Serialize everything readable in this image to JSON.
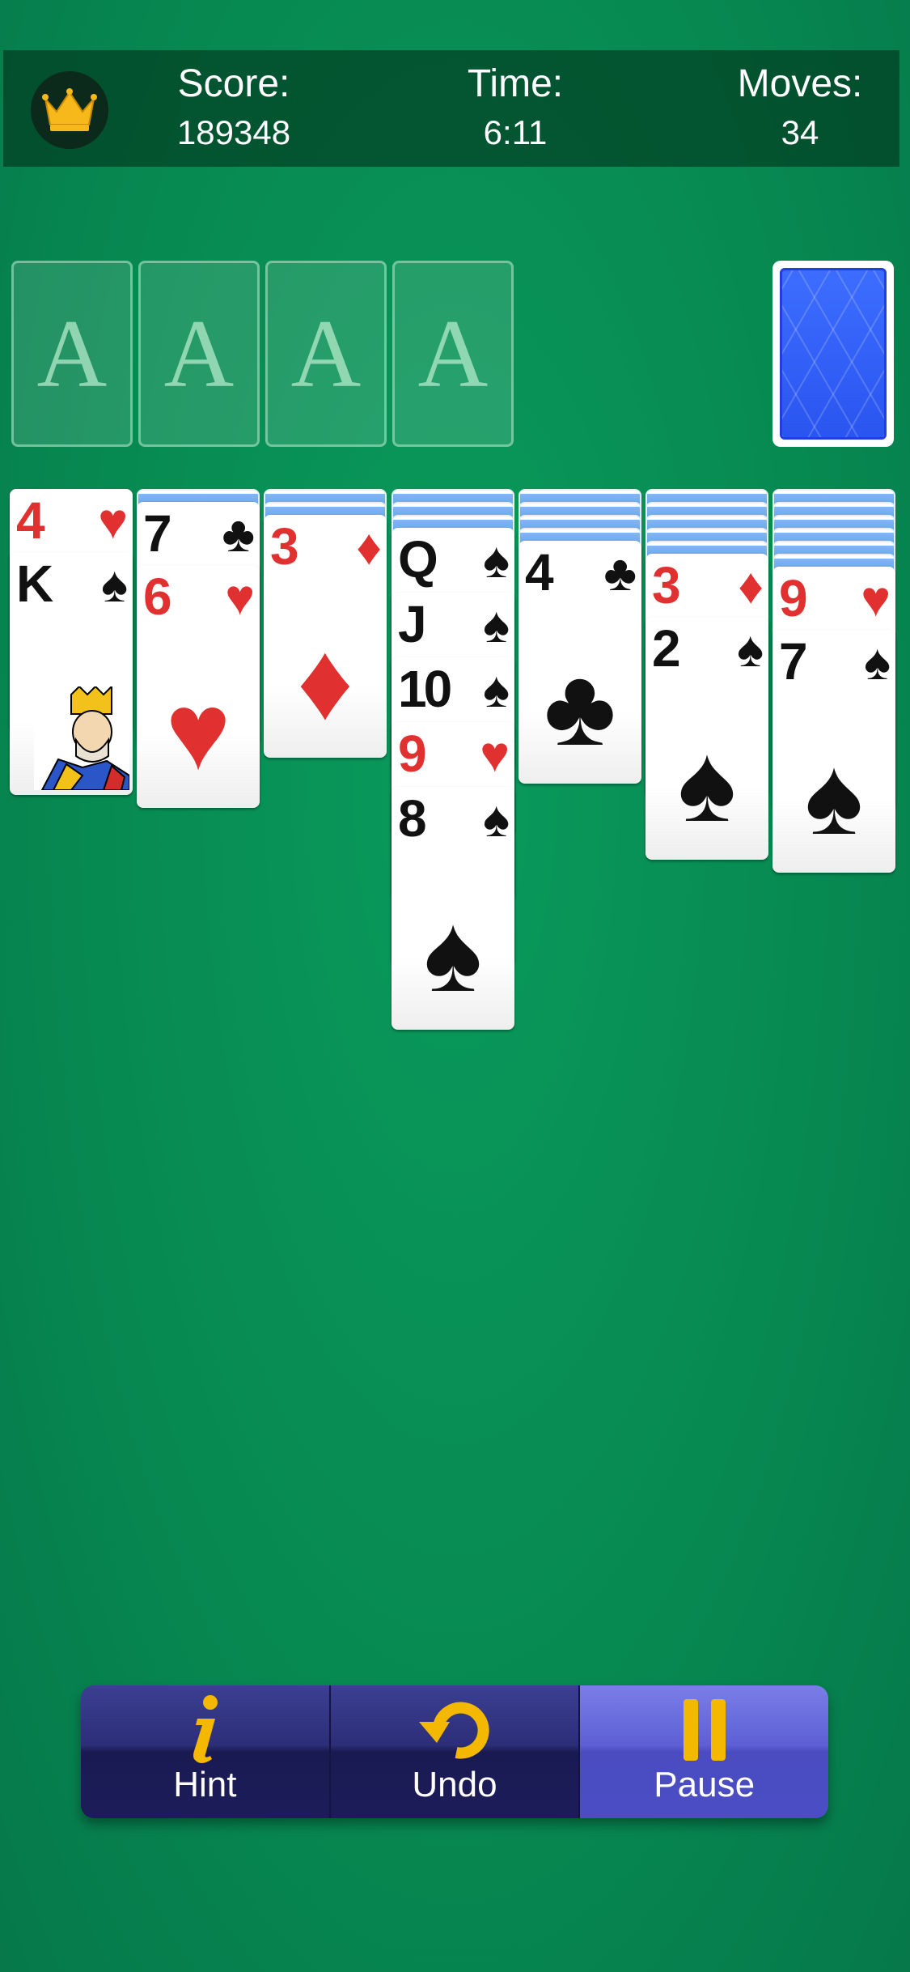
{
  "header": {
    "score_label": "Score:",
    "score_value": "189348",
    "time_label": "Time:",
    "time_value": "6:11",
    "moves_label": "Moves:",
    "moves_value": "34",
    "crown_icon": "crown-icon"
  },
  "foundations": [
    "A",
    "A",
    "A",
    "A"
  ],
  "stock": {
    "icon": "card-back"
  },
  "tableau": [
    {
      "hidden": 0,
      "cards": [
        {
          "rank": "4",
          "suit": "♥",
          "color": "red"
        },
        {
          "rank": "K",
          "suit": "♠",
          "color": "black"
        }
      ]
    },
    {
      "hidden": 1,
      "cards": [
        {
          "rank": "7",
          "suit": "♣",
          "color": "black"
        },
        {
          "rank": "6",
          "suit": "♥",
          "color": "red"
        }
      ]
    },
    {
      "hidden": 2,
      "cards": [
        {
          "rank": "3",
          "suit": "♦",
          "color": "red"
        }
      ]
    },
    {
      "hidden": 3,
      "cards": [
        {
          "rank": "Q",
          "suit": "♠",
          "color": "black"
        },
        {
          "rank": "J",
          "suit": "♠",
          "color": "black"
        },
        {
          "rank": "10",
          "suit": "♠",
          "color": "black"
        },
        {
          "rank": "9",
          "suit": "♥",
          "color": "red"
        },
        {
          "rank": "8",
          "suit": "♠",
          "color": "black"
        }
      ]
    },
    {
      "hidden": 4,
      "cards": [
        {
          "rank": "4",
          "suit": "♣",
          "color": "black"
        }
      ]
    },
    {
      "hidden": 5,
      "cards": [
        {
          "rank": "3",
          "suit": "♦",
          "color": "red"
        },
        {
          "rank": "2",
          "suit": "♠",
          "color": "black"
        }
      ]
    },
    {
      "hidden": 6,
      "cards": [
        {
          "rank": "9",
          "suit": "♥",
          "color": "red"
        },
        {
          "rank": "7",
          "suit": "♠",
          "color": "black"
        }
      ]
    }
  ],
  "toolbar": {
    "hint_label": "Hint",
    "undo_label": "Undo",
    "pause_label": "Pause",
    "accent": "#f5b800"
  }
}
